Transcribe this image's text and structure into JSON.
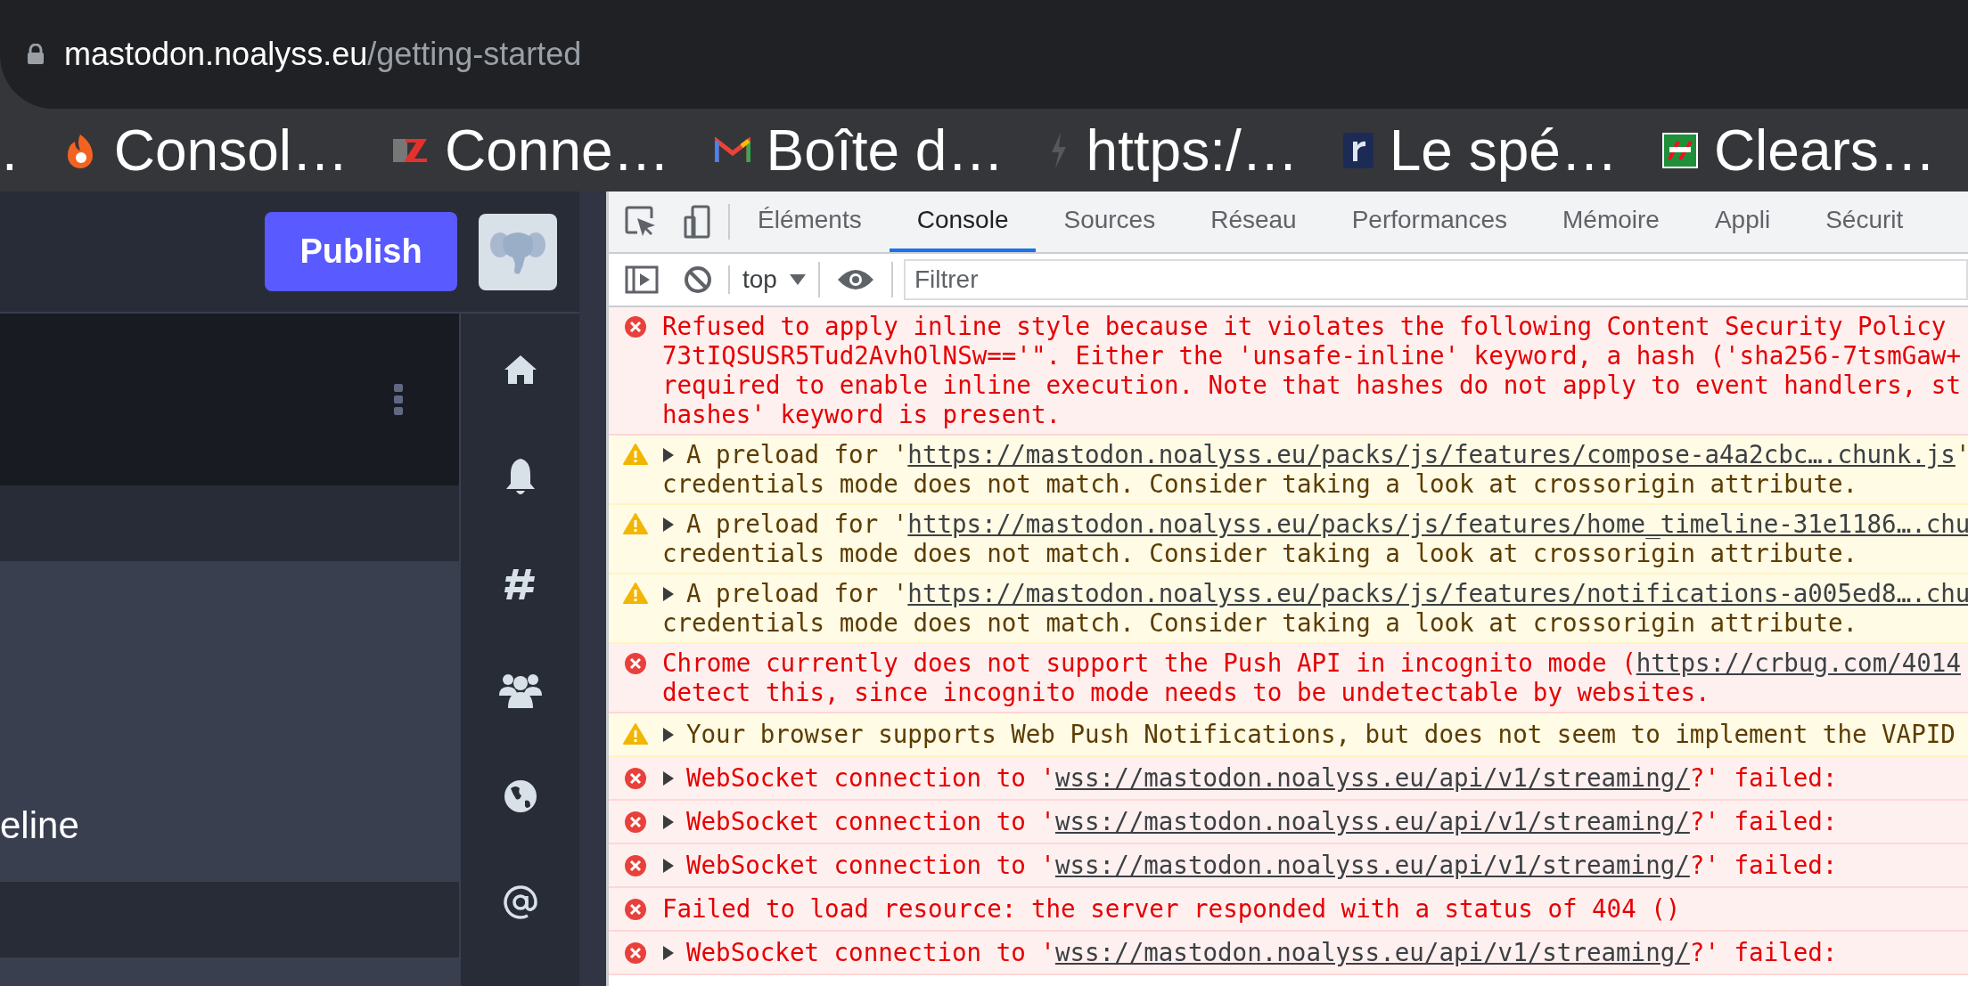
{
  "address_bar": {
    "host": "mastodon.noalyss.eu",
    "path": "/getting-started"
  },
  "bookmarks": [
    {
      "label": "."
    },
    {
      "label": "Consol…"
    },
    {
      "label": "Conne…"
    },
    {
      "label": "Boîte d…"
    },
    {
      "label": "https:/…"
    },
    {
      "label": "Le spé…"
    },
    {
      "label": "Clears…"
    }
  ],
  "app": {
    "publish_button": "Publish",
    "column_text": "eline"
  },
  "devtools": {
    "tabs": [
      {
        "label": "Éléments",
        "selected": false
      },
      {
        "label": "Console",
        "selected": true
      },
      {
        "label": "Sources",
        "selected": false
      },
      {
        "label": "Réseau",
        "selected": false
      },
      {
        "label": "Performances",
        "selected": false
      },
      {
        "label": "Mémoire",
        "selected": false
      },
      {
        "label": "Appli",
        "selected": false
      },
      {
        "label": "Sécurit",
        "selected": false
      }
    ],
    "context": "top",
    "filter": {
      "placeholder": "Filtrer"
    },
    "messages": [
      {
        "kind": "error",
        "expandable": false,
        "lines": [
          [
            {
              "text": "Refused to apply inline style because it violates the following Content Security Policy",
              "link": false
            }
          ],
          [
            {
              "text": "73tIQSUSR5Tud2AvhOlNSw=='\". Either the 'unsafe-inline' keyword, a hash ('sha256-7tsmGaw+",
              "link": false
            }
          ],
          [
            {
              "text": "required to enable inline execution. Note that hashes do not apply to event handlers, st",
              "link": false
            }
          ],
          [
            {
              "text": "hashes' keyword is present.",
              "link": false
            }
          ]
        ]
      },
      {
        "kind": "warning",
        "expandable": true,
        "lines": [
          [
            {
              "text": "A preload for '",
              "link": false
            },
            {
              "text": "https://mastodon.noalyss.eu/packs/js/features/compose-a4a2cbc….chunk.js",
              "link": true
            },
            {
              "text": "'",
              "link": false
            }
          ],
          [
            {
              "text": "credentials mode does not match. Consider taking a look at crossorigin attribute.",
              "link": false
            }
          ]
        ]
      },
      {
        "kind": "warning",
        "expandable": true,
        "lines": [
          [
            {
              "text": "A preload for '",
              "link": false
            },
            {
              "text": "https://mastodon.noalyss.eu/packs/js/features/home_timeline-31e1186….chu",
              "link": true
            }
          ],
          [
            {
              "text": "credentials mode does not match. Consider taking a look at crossorigin attribute.",
              "link": false
            }
          ]
        ]
      },
      {
        "kind": "warning",
        "expandable": true,
        "lines": [
          [
            {
              "text": "A preload for '",
              "link": false
            },
            {
              "text": "https://mastodon.noalyss.eu/packs/js/features/notifications-a005ed8….chu",
              "link": true
            }
          ],
          [
            {
              "text": "credentials mode does not match. Consider taking a look at crossorigin attribute.",
              "link": false
            }
          ]
        ]
      },
      {
        "kind": "error",
        "expandable": false,
        "lines": [
          [
            {
              "text": "Chrome currently does not support the Push API in incognito mode (",
              "link": false
            },
            {
              "text": "https://crbug.com/4014",
              "link": true
            }
          ],
          [
            {
              "text": "detect this, since incognito mode needs to be undetectable by websites.",
              "link": false
            }
          ]
        ]
      },
      {
        "kind": "warning",
        "expandable": true,
        "lines": [
          [
            {
              "text": "Your browser supports Web Push Notifications, but does not seem to implement the VAPID",
              "link": false
            }
          ]
        ]
      },
      {
        "kind": "error",
        "expandable": true,
        "lines": [
          [
            {
              "text": "WebSocket connection to '",
              "link": false
            },
            {
              "text": "wss://mastodon.noalyss.eu/api/v1/streaming/",
              "link": true
            },
            {
              "text": "?' failed:",
              "link": false
            }
          ]
        ]
      },
      {
        "kind": "error",
        "expandable": true,
        "lines": [
          [
            {
              "text": "WebSocket connection to '",
              "link": false
            },
            {
              "text": "wss://mastodon.noalyss.eu/api/v1/streaming/",
              "link": true
            },
            {
              "text": "?' failed:",
              "link": false
            }
          ]
        ]
      },
      {
        "kind": "error",
        "expandable": true,
        "lines": [
          [
            {
              "text": "WebSocket connection to '",
              "link": false
            },
            {
              "text": "wss://mastodon.noalyss.eu/api/v1/streaming/",
              "link": true
            },
            {
              "text": "?' failed:",
              "link": false
            }
          ]
        ]
      },
      {
        "kind": "error",
        "expandable": false,
        "lines": [
          [
            {
              "text": "Failed to load resource: the server responded with a status of 404 ()",
              "link": false
            }
          ]
        ]
      },
      {
        "kind": "error",
        "expandable": true,
        "lines": [
          [
            {
              "text": "WebSocket connection to '",
              "link": false
            },
            {
              "text": "wss://mastodon.noalyss.eu/api/v1/streaming/",
              "link": true
            },
            {
              "text": "?' failed:",
              "link": false
            }
          ]
        ]
      }
    ]
  }
}
